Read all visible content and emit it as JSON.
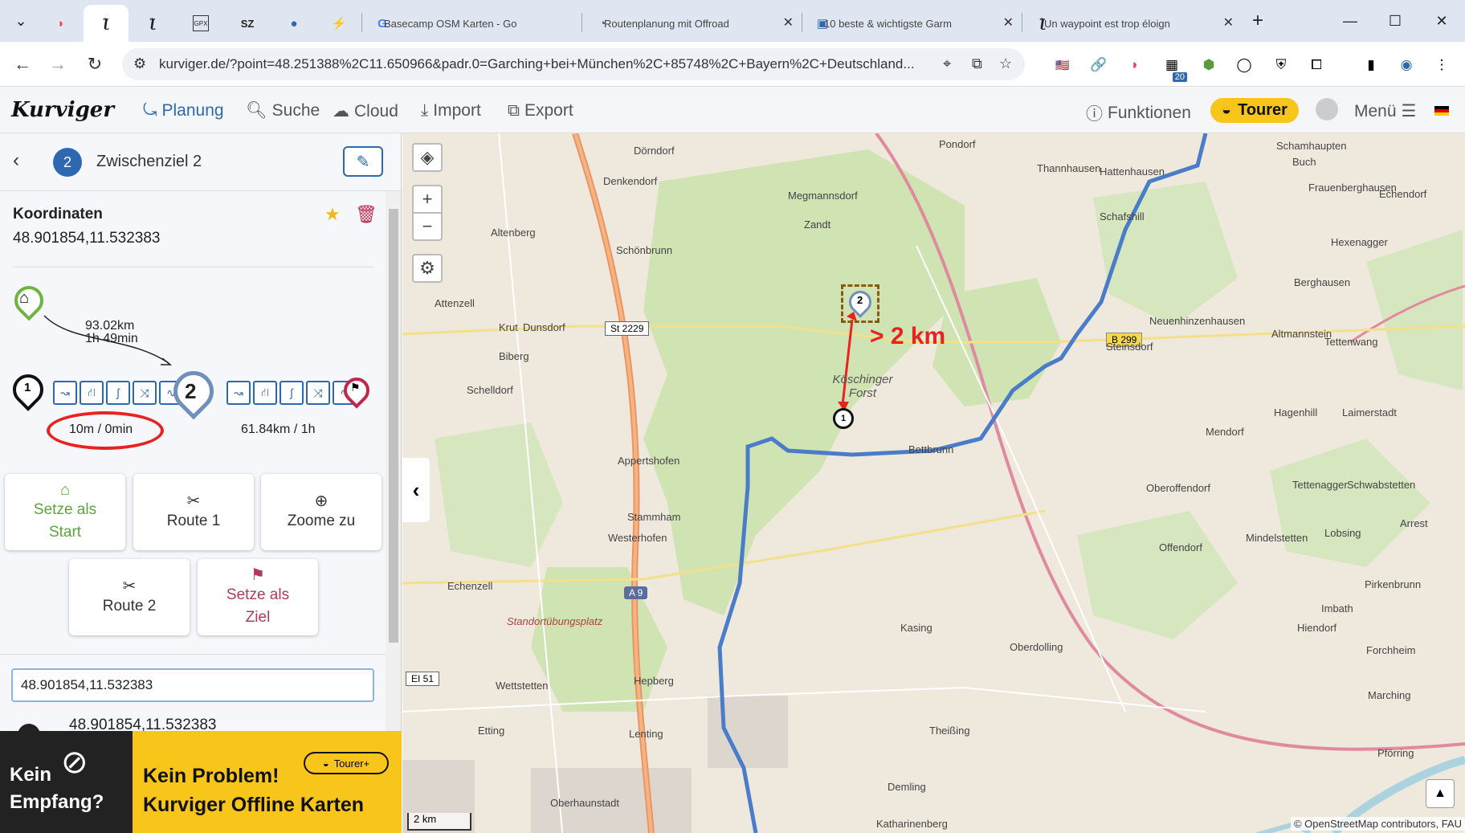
{
  "browser": {
    "tabs": [
      {
        "label": "",
        "icon": "pocket-icon"
      },
      {
        "label": "",
        "icon": "kurviger-icon"
      },
      {
        "label": "",
        "icon": "kurviger-icon"
      },
      {
        "label": "",
        "icon": "gpx-icon"
      },
      {
        "label": "",
        "icon": "sz-icon"
      },
      {
        "label": "",
        "icon": "person-icon"
      },
      {
        "label": "",
        "icon": "bolt-icon"
      },
      {
        "label": "Basecamp OSM Karten - Go",
        "icon": "google-icon"
      },
      {
        "label": "Routenplanung mit Offroad",
        "icon": "route-icon"
      },
      {
        "label": "10 beste & wichtigste Garm",
        "icon": "site-icon"
      },
      {
        "label": "Un waypoint est trop éloign",
        "icon": "kurviger-icon"
      }
    ],
    "url": "kurviger.de/?point=48.251388%2C11.650966&padr.0=Garching+bei+München%2C+85748%2C+Bayern%2C+Deutschland...",
    "ext_badge": "20"
  },
  "app": {
    "logo": "Kurviger",
    "nav": {
      "planung": "Planung",
      "suche": "Suche",
      "cloud": "Cloud",
      "import": "Import",
      "export": "Export"
    },
    "funktionen": "Funktionen",
    "tourer": "Tourer",
    "menu": "Menü"
  },
  "panel": {
    "waypoint_number": "2",
    "title": "Zwischenziel 2",
    "section_label": "Koordinaten",
    "coordinates": "48.901854,11.532383",
    "leg_to_here": {
      "distance": "93.02km",
      "time": "1h 49min"
    },
    "wp1_number": "1",
    "wp2_number": "2",
    "leg_1_2": "10m / 0min",
    "leg_2_end": "61.84km / 1h",
    "buttons": {
      "set_start": [
        "Setze als",
        "Start"
      ],
      "route1": "Route 1",
      "zoom": "Zoome zu",
      "route2": "Route 2",
      "set_end": [
        "Setze als",
        "Ziel"
      ]
    },
    "search_value": "48.901854,11.532383",
    "result": "48.901854,11.532383"
  },
  "banner": {
    "left": [
      "Kein",
      "Empfang?"
    ],
    "right": [
      "Kein Problem!",
      "Kurviger Offline Karten"
    ],
    "badge": "Tourer+"
  },
  "map": {
    "annotation": "> 2 km",
    "scale": "2 km",
    "attribution": "© OpenStreetMap contributors, FAU",
    "marker_1": "1",
    "marker_2": "2",
    "road_labels": [
      "St 2229",
      "A 9",
      "B 299",
      "EI 51"
    ],
    "places": [
      "Dörndorf",
      "Pondorf",
      "Schamhaupten",
      "Buch",
      "Denkendorf",
      "Megmannsdorf",
      "Thannhausen",
      "Hattenhausen",
      "Frauenberghausen",
      "Echendorf",
      "Zandt",
      "Altenberg",
      "Schönbrunn",
      "Schafshill",
      "Hexenagger",
      "Berghausen",
      "Attenzell",
      "Krut",
      "Dunsdorf",
      "Neuenhinzenhausen",
      "Altmannstein",
      "Tettenwang",
      "Biberg",
      "Köschinger Forst",
      "Steinsdorf",
      "Schelldorf",
      "Hagenhill",
      "Laimerstadt",
      "Appertshofen",
      "Mendorf",
      "Tettenagger",
      "Schwabstetten",
      "Stammham",
      "Westerhofen",
      "Oberoffendorf",
      "Offendorf",
      "Lobsing",
      "Mindelstetten",
      "Echenzell",
      "Imbath",
      "Pirkenbrunn",
      "Standortübungsplatz",
      "Kasing",
      "Hiendorf",
      "Wettstetten",
      "Hepberg",
      "Oberdolling",
      "Forchheim",
      "Etting",
      "Lenting",
      "Theißing",
      "Marching",
      "Pförring",
      "Demling",
      "Oberhaunstadt",
      "Katharinenberg",
      "Bettbrunn",
      "Arrest"
    ]
  },
  "colors": {
    "accent": "#2d68b0",
    "route": "#4a7cc9",
    "tourer": "#f8c51a",
    "annotation": "#e8231f",
    "forest": "#cfe3b3"
  }
}
